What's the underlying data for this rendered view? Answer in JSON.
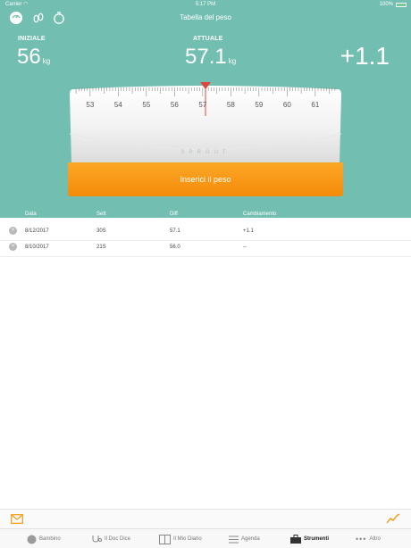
{
  "status": {
    "carrier": "Carrier",
    "time": "5:17 PM",
    "battery": "100%"
  },
  "nav": {
    "title": "Tabella del peso"
  },
  "stats": {
    "initial_label": "INIZIALE",
    "initial_value": "56",
    "initial_unit": "kg",
    "current_label": "ATTUALE",
    "current_value": "57.1",
    "current_unit": "kg",
    "diff_value": "+1.1"
  },
  "scale": {
    "ticks": [
      "53",
      "54",
      "55",
      "56",
      "57",
      "58",
      "59",
      "60",
      "61"
    ],
    "brand": "SPROUT",
    "pointer_value": 57.1
  },
  "cta": {
    "label": "Inserici il peso"
  },
  "table": {
    "headers": [
      "Data",
      "Sett",
      "Diff",
      "Cambiamento"
    ],
    "rows": [
      {
        "date": "8/12/2017",
        "week": "30S",
        "diff": "57.1",
        "change": "+1.1"
      },
      {
        "date": "8/10/2017",
        "week": "21S",
        "diff": "56.0",
        "change": "--"
      }
    ]
  },
  "tabs": [
    {
      "label": "Bambino",
      "icon": "baby-icon"
    },
    {
      "label": "Il Doc Dice",
      "icon": "stethoscope-icon"
    },
    {
      "label": "Il Mio Diario",
      "icon": "book-icon"
    },
    {
      "label": "Agenda",
      "icon": "list-icon"
    },
    {
      "label": "Strumenti",
      "icon": "toolbox-icon",
      "active": true
    },
    {
      "label": "Altro",
      "icon": "more-icon"
    }
  ],
  "colors": {
    "header": "#72bfb1",
    "cta": "#f79a13",
    "pointer": "#e0443a"
  }
}
